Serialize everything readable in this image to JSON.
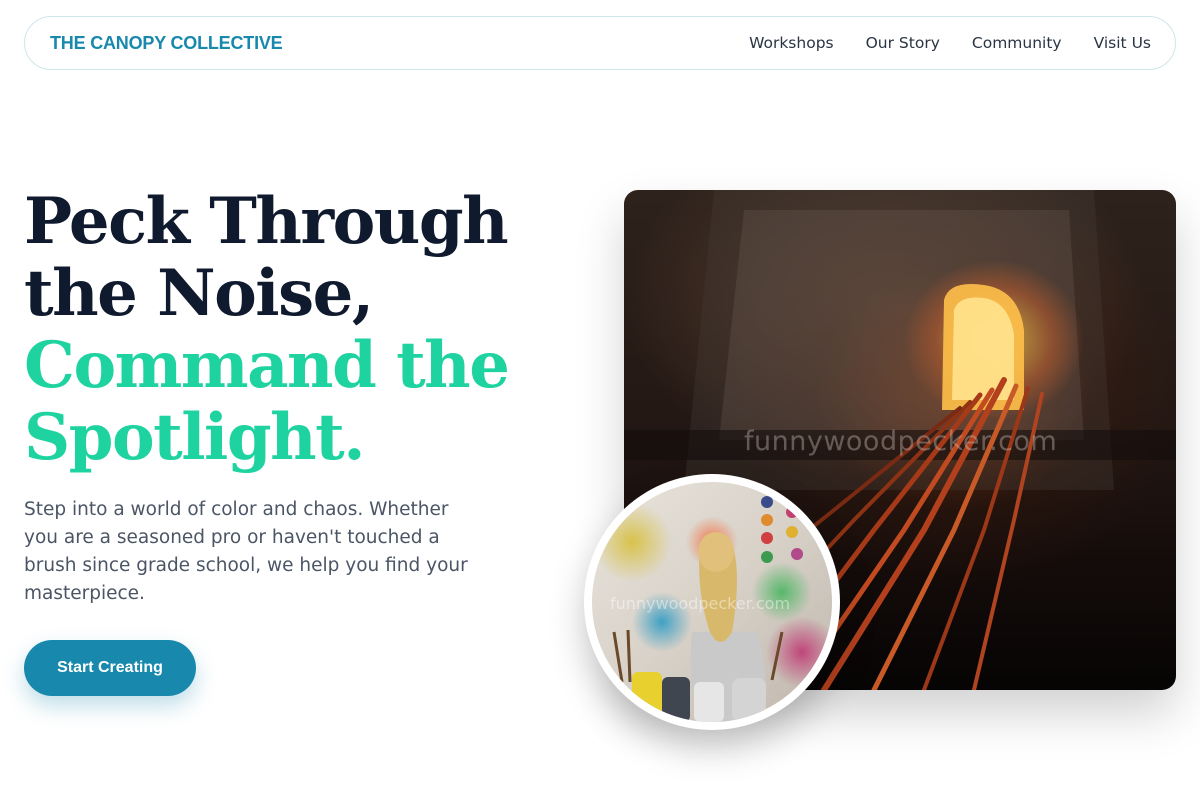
{
  "brand": {
    "name": "THE CANOPY COLLECTIVE"
  },
  "nav": {
    "items": [
      "Workshops",
      "Our Story",
      "Community",
      "Visit Us"
    ]
  },
  "hero": {
    "headline_line1": "Peck Through",
    "headline_line2": "the Noise,",
    "headline_accent_line1": "Command the",
    "headline_accent_line2": "Spotlight.",
    "subtext": "Step into a world of color and chaos. Whether you are a seasoned pro or haven't touched a brush since grade school, we help you find your masterpiece.",
    "cta_label": "Start Creating"
  },
  "images": {
    "main_watermark": "funnywoodpecker.com",
    "inset_watermark": "funnywoodpecker.com"
  },
  "colors": {
    "brand": "#1889ac",
    "accent": "#1fd3a0",
    "heading": "#101a2e",
    "body_text": "#4b5565"
  }
}
